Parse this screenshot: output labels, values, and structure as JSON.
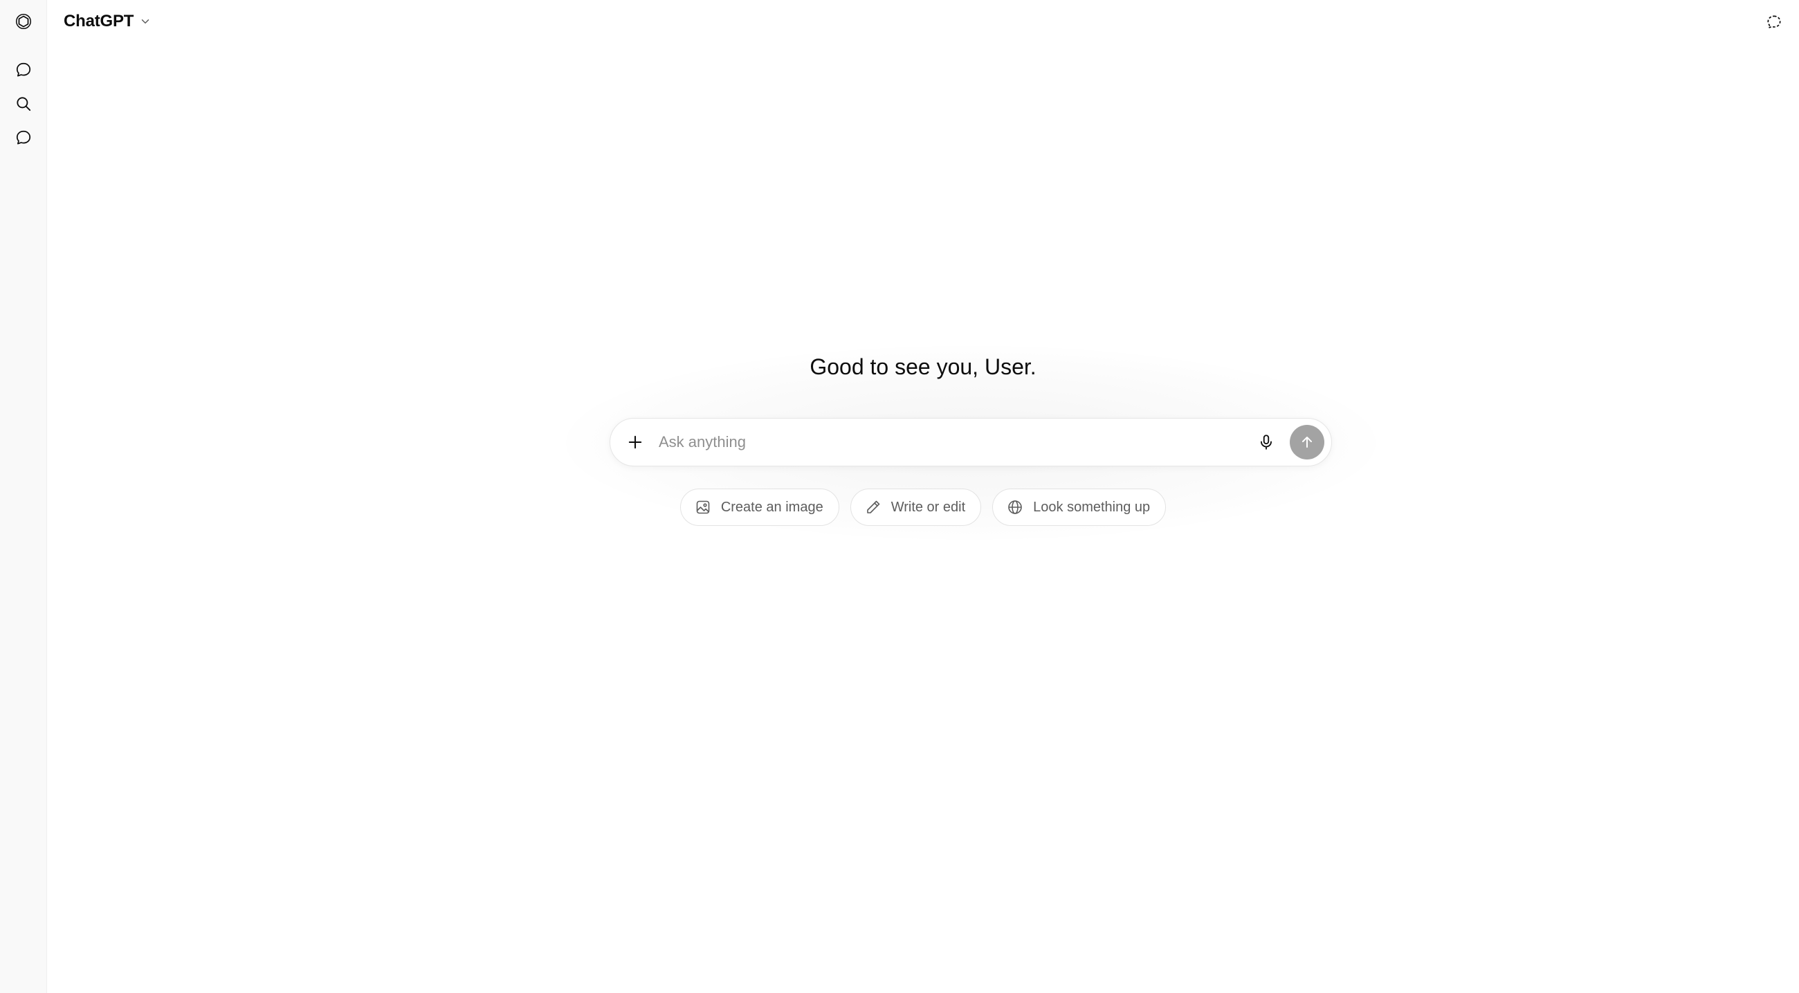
{
  "header": {
    "model_name": "ChatGPT",
    "model_icon": "chevron-down-icon",
    "right_icon": "temporary-chat-icon"
  },
  "sidebar": {
    "logo_icon": "openai-logo-icon",
    "items": [
      {
        "icon": "new-chat-icon"
      },
      {
        "icon": "search-icon"
      },
      {
        "icon": "chat-bubble-icon"
      }
    ]
  },
  "main": {
    "greeting": "Good to see you, User.",
    "composer": {
      "placeholder": "Ask anything",
      "value": "",
      "plus_icon": "plus-icon",
      "mic_icon": "microphone-icon",
      "send_icon": "arrow-up-icon"
    },
    "suggestions": [
      {
        "label": "Create an image",
        "icon": "image-icon"
      },
      {
        "label": "Write or edit",
        "icon": "pencil-icon"
      },
      {
        "label": "Look something up",
        "icon": "globe-icon"
      }
    ]
  },
  "colors": {
    "background": "#ffffff",
    "sidebar_background": "#f9f9f9",
    "send_button": "#a3a3a3",
    "placeholder_text": "#8f8f8f",
    "chip_text": "#5d5d5d"
  }
}
